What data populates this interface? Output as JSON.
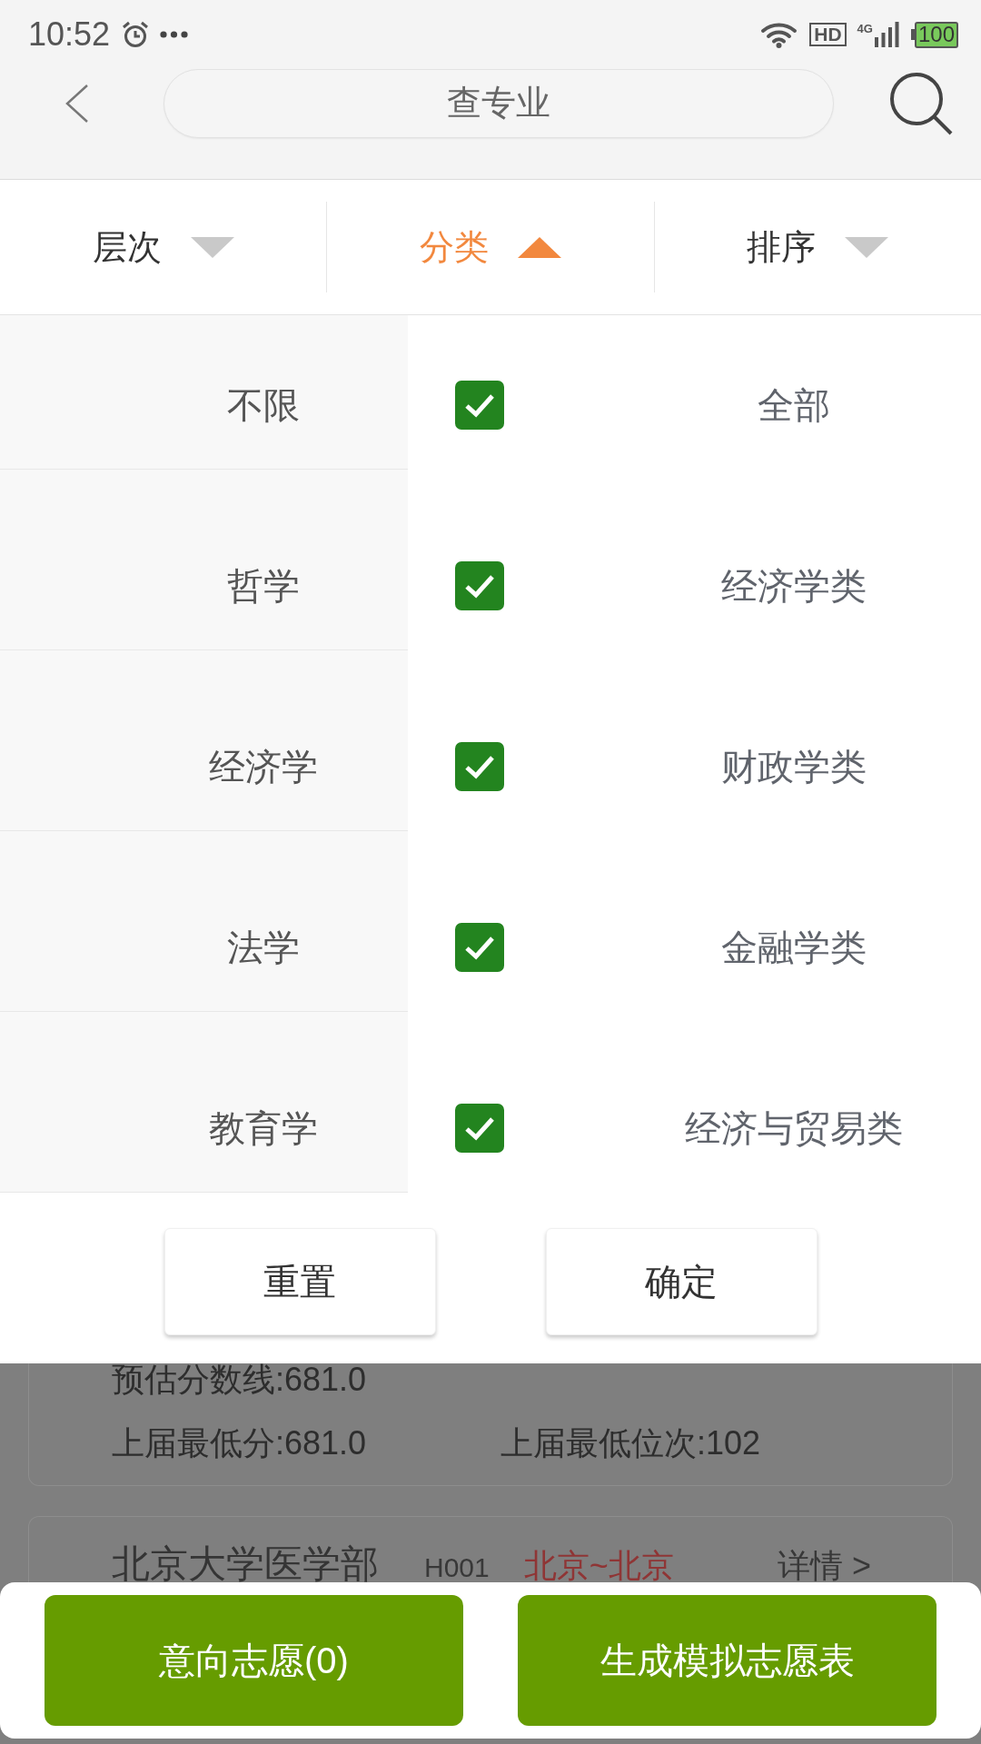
{
  "status_bar": {
    "time": "10:52",
    "hd_label": "HD",
    "network_label": "4G",
    "battery": "100"
  },
  "header": {
    "title": "查专业"
  },
  "filter_tabs": [
    {
      "label": "层次",
      "selected": false
    },
    {
      "label": "分类",
      "selected": true
    },
    {
      "label": "排序",
      "selected": false
    }
  ],
  "category_list": [
    {
      "label": "不限",
      "selected": false
    },
    {
      "label": "哲学",
      "selected": false
    },
    {
      "label": "经济学",
      "selected": false
    },
    {
      "label": "法学",
      "selected": false
    },
    {
      "label": "教育学",
      "selected": false
    }
  ],
  "subcategory_list": [
    {
      "label": "全部",
      "checked": true
    },
    {
      "label": "经济学类",
      "checked": true
    },
    {
      "label": "财政学类",
      "checked": true
    },
    {
      "label": "金融学类",
      "checked": true
    },
    {
      "label": "经济与贸易类",
      "checked": true
    }
  ],
  "filter_actions": [
    "重置",
    "确定"
  ],
  "results": [
    {
      "kind": "stats",
      "estimated_line": "预估分数线:681.0",
      "last_min_score": "上届最低分:681.0",
      "last_min_rank": "上届最低位次:102"
    },
    {
      "kind": "heading",
      "name": "北京大学医学部",
      "code": "H001",
      "location": "北京~北京",
      "details_link": "详情 >"
    }
  ],
  "bottom_actions": [
    "意向志愿(0)",
    "生成模拟志愿表"
  ]
}
